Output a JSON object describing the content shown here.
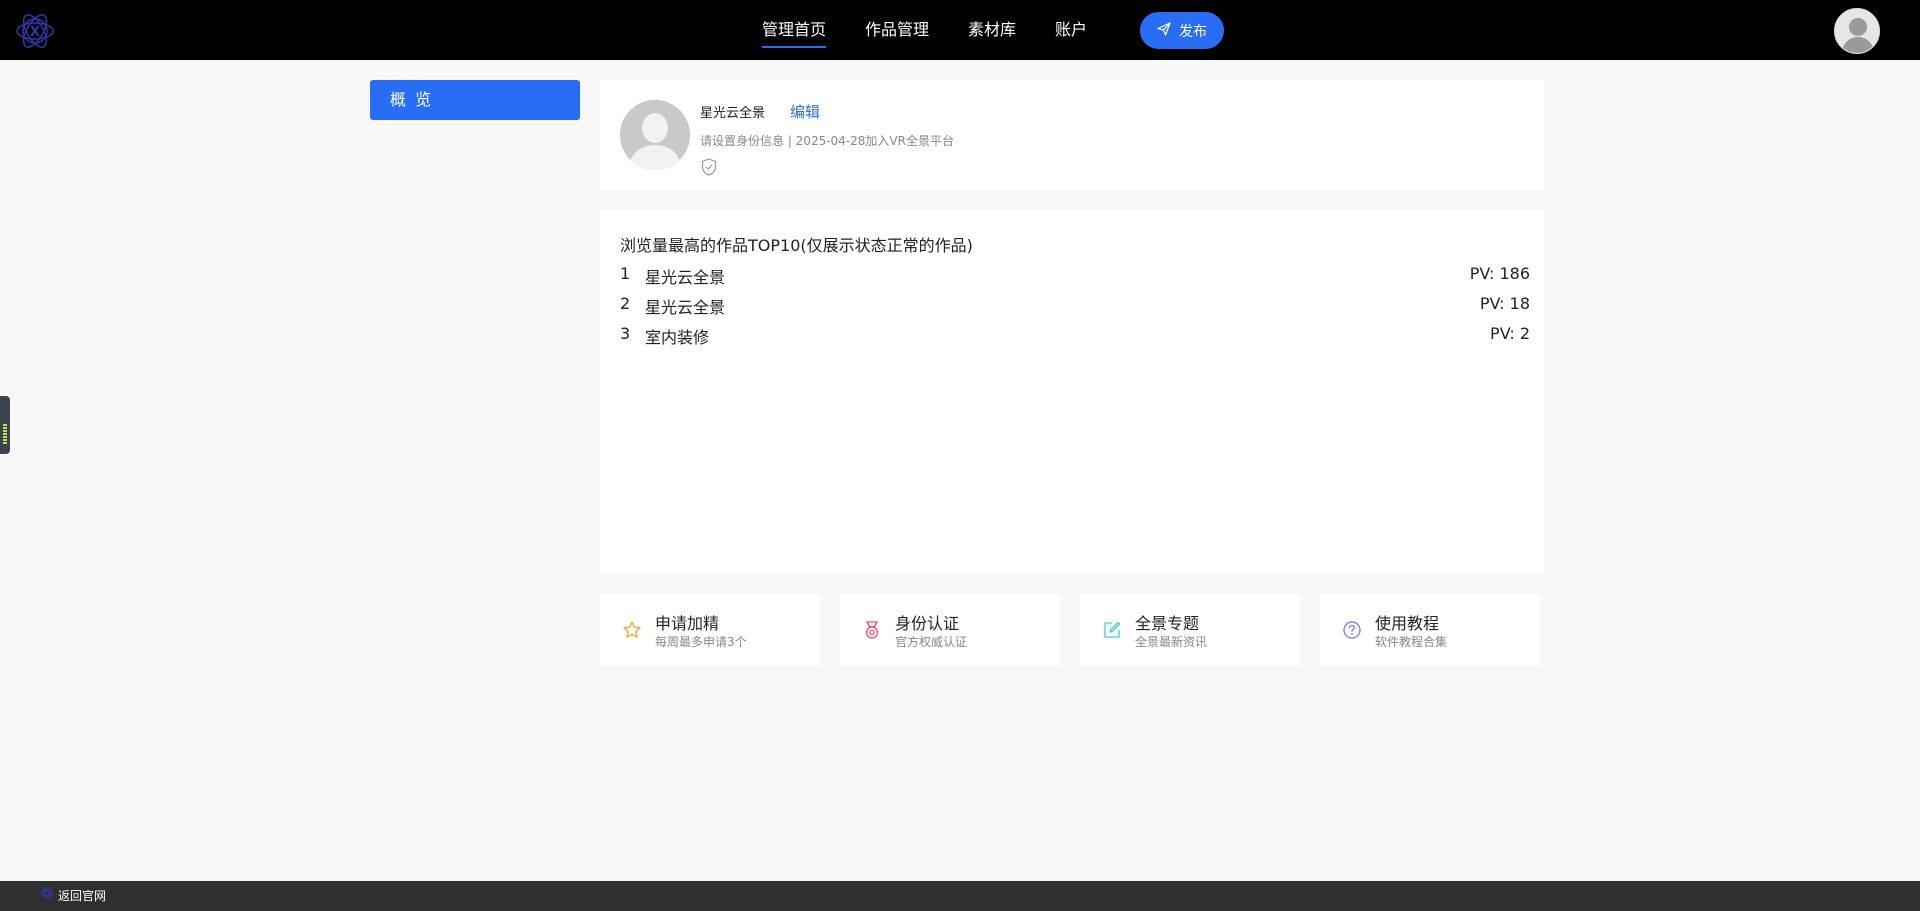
{
  "header": {
    "nav": [
      {
        "label": "管理首页",
        "active": true
      },
      {
        "label": "作品管理",
        "active": false
      },
      {
        "label": "素材库",
        "active": false
      },
      {
        "label": "账户",
        "active": false
      }
    ],
    "publish_label": "发布",
    "accent_color": "#2a6df5"
  },
  "sidebar": {
    "items": [
      {
        "label": "概 览",
        "active": true
      }
    ]
  },
  "profile": {
    "name": "星光云全景",
    "edit_label": "编辑",
    "subtitle": "请设置身份信息 | 2025-04-28加入VR全景平台"
  },
  "top10": {
    "title": "浏览量最高的作品TOP10(仅展示状态正常的作品)",
    "rows": [
      {
        "rank": "1",
        "name": "星光云全景",
        "pv": "PV: 186"
      },
      {
        "rank": "2",
        "name": "星光云全景",
        "pv": "PV: 18"
      },
      {
        "rank": "3",
        "name": "室内装修",
        "pv": "PV: 2"
      }
    ]
  },
  "quick_links": [
    {
      "title": "申请加精",
      "desc": "每周最多申请3个",
      "icon": "star-icon",
      "color": "#f5a623"
    },
    {
      "title": "身份认证",
      "desc": "官方权威认证",
      "icon": "medal-icon",
      "color": "#f04e5e"
    },
    {
      "title": "全景专题",
      "desc": "全景最新资讯",
      "icon": "edit-icon",
      "color": "#3fd0d4"
    },
    {
      "title": "使用教程",
      "desc": "软件教程合集",
      "icon": "help-icon",
      "color": "#8a6cf0"
    }
  ],
  "footer": {
    "back_label": "返回官网"
  }
}
